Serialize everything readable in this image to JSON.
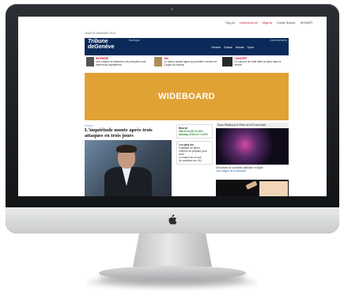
{
  "screen": {
    "topbar": {
      "items": [
        "Tdg.ch",
        "LesEchos.ch",
        "Migros",
        "Credit Suisse",
        "SIGNER"
      ]
    },
    "meta": "Jeudi 18 Décembre 2014",
    "header": {
      "logo_line1": "Tribune",
      "logo_line2": "deGenève",
      "ad_left": "Boutique",
      "ad_right": "Abonnements",
      "nav": [
        "Genève",
        "Suisse",
        "Monde",
        "Sport"
      ]
    },
    "teasers": [
      {
        "kicker": "INCENDIE",
        "text": "Une maison en flammes, les pompiers sont intervenus rapidement"
      },
      {
        "kicker": "SKI",
        "text": "Le skieur suisse signe sa première victoire en Coupe du monde"
      },
      {
        "kicker": "CONCERT",
        "text": "Le concert de Noël attire la foule dans le centre"
      }
    ],
    "wideboard": "WIDEBOARD",
    "article": {
      "kicker": "France",
      "headline": "L'inquiétude monte après trois attaques en trois jours"
    },
    "middle": {
      "box1_title": "Bourse",
      "box1_lines": [
        "SMI 8714.65 +0.45%",
        "Nasdaq 4745.24 +1.03%"
      ],
      "box2_title": "Les plus lus",
      "box2_lines": [
        "Fusillade en direct",
        "Genève se prépare pour Noël",
        "Le match de ce soir",
        "Un accident sur l'A1"
      ]
    },
    "right": {
      "heading": "Nous Réalisons le Rêve de la Promenade",
      "text": "Découvrez la nouvelle collection en ligne",
      "link": "Les images de la semaine"
    }
  }
}
